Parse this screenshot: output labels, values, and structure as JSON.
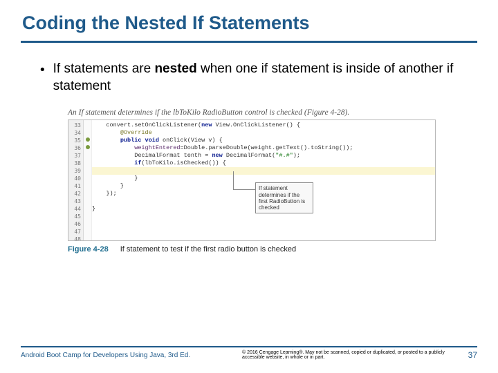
{
  "title": "Coding the Nested If Statements",
  "bullet": {
    "pre": "If statements are ",
    "bold": "nested",
    "post": " when one if statement is inside of another if statement"
  },
  "figure": {
    "note": "An If statement determines if the lbToKilo RadioButton control is checked (Figure 4-28).",
    "label": "Figure 4-28",
    "caption": "If statement to test if the first radio button is checked",
    "callout": "If statement determines if the first RadioButton is checked",
    "gutter": [
      "33",
      "34",
      "35",
      "36",
      "37",
      "38",
      "39",
      "40",
      "41",
      "42",
      "43",
      "44",
      "45",
      "46",
      "47",
      "48"
    ],
    "code": {
      "l1_a": "convert.setOnClickListener(",
      "l1_b": "new",
      "l1_c": " View.OnClickListener() {",
      "l2": "@Override",
      "l3_a": "public void",
      "l3_b": " onClick(View v) {",
      "l4_a": "weightEntered",
      "l4_b": "=Double.parseDouble(weight.getText().toString());",
      "l5_a": "DecimalFormat tenth = ",
      "l5_b": "new",
      "l5_c": " DecimalFormat(",
      "l5_d": "\"#.#\"",
      "l5_e": ");",
      "l6_a": "if",
      "l6_b": "(lbToKilo.isChecked()) {",
      "l7": "}",
      "l8": "}",
      "l9": "});",
      "l10": "}"
    }
  },
  "footer": {
    "left": "Android Boot Camp for Developers Using Java, 3rd Ed.",
    "mid": "© 2016 Cengage Learning®. May not be scanned, copied or duplicated, or posted to a publicly accessible website, in whole or in part.",
    "num": "37"
  }
}
